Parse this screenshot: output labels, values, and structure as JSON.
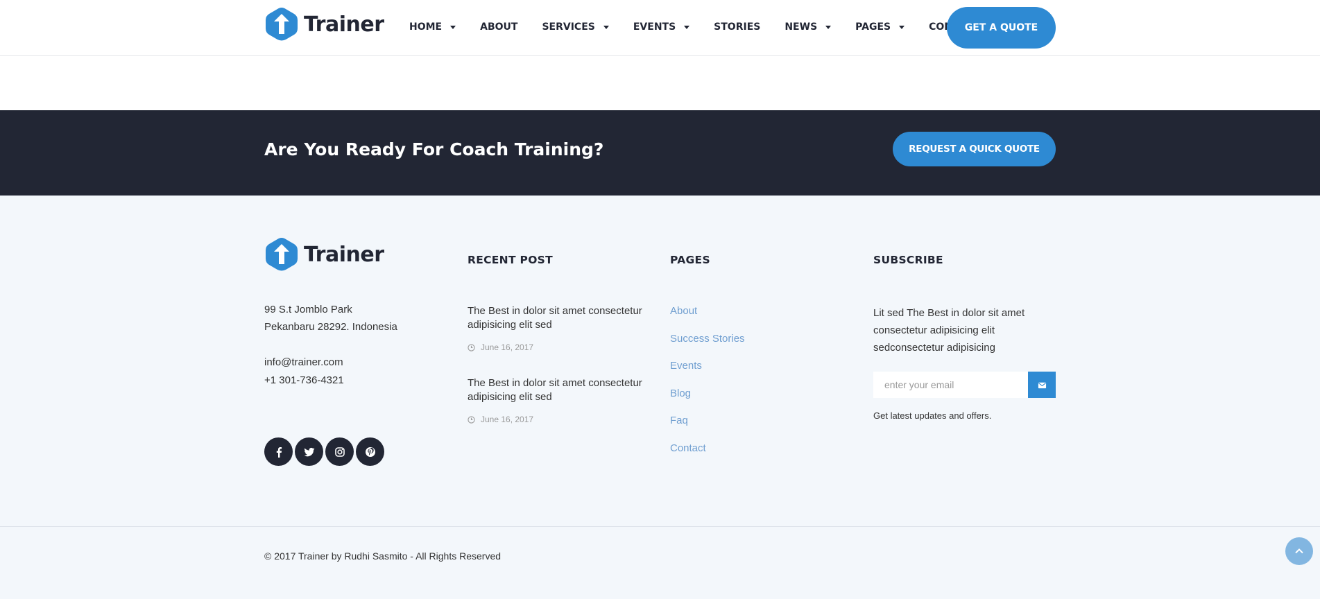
{
  "brand": {
    "name": "Trainer",
    "accent": "#2e8ad3",
    "dark": "#222634"
  },
  "nav": {
    "items": [
      {
        "label": "HOME",
        "has_dropdown": true
      },
      {
        "label": "ABOUT",
        "has_dropdown": false
      },
      {
        "label": "SERVICES",
        "has_dropdown": true
      },
      {
        "label": "EVENTS",
        "has_dropdown": true
      },
      {
        "label": "STORIES",
        "has_dropdown": false
      },
      {
        "label": "NEWS",
        "has_dropdown": true
      },
      {
        "label": "PAGES",
        "has_dropdown": true
      },
      {
        "label": "CONTACT",
        "has_dropdown": false
      }
    ],
    "quote_label": "GET A QUOTE"
  },
  "cta": {
    "title": "Are You Ready For Coach Training?",
    "button_label": "REQUEST A QUICK QUOTE"
  },
  "footer": {
    "address_line1": "99 S.t Jomblo Park",
    "address_line2": "Pekanbaru 28292. Indonesia",
    "email": "info@trainer.com",
    "phone": "+1 301-736-4321",
    "socials": [
      "facebook-icon",
      "twitter-icon",
      "instagram-icon",
      "pinterest-icon"
    ],
    "recent": {
      "title": "RECENT POST",
      "posts": [
        {
          "title": "The Best in dolor sit amet consectetur adipisicing elit sed",
          "date": "June 16, 2017"
        },
        {
          "title": "The Best in dolor sit amet consectetur adipisicing elit sed",
          "date": "June 16, 2017"
        }
      ]
    },
    "pages": {
      "title": "PAGES",
      "items": [
        "About",
        "Success Stories",
        "Events",
        "Blog",
        "Faq",
        "Contact"
      ]
    },
    "subscribe": {
      "title": "SUBSCRIBE",
      "text": "Lit sed The Best in dolor sit amet consectetur adipisicing elit sedconsectetur adipisicing",
      "placeholder": "enter your email",
      "value": "",
      "note": "Get latest updates and offers."
    },
    "copyright": "© 2017 Trainer by Rudhi Sasmito - All Rights Reserved"
  }
}
